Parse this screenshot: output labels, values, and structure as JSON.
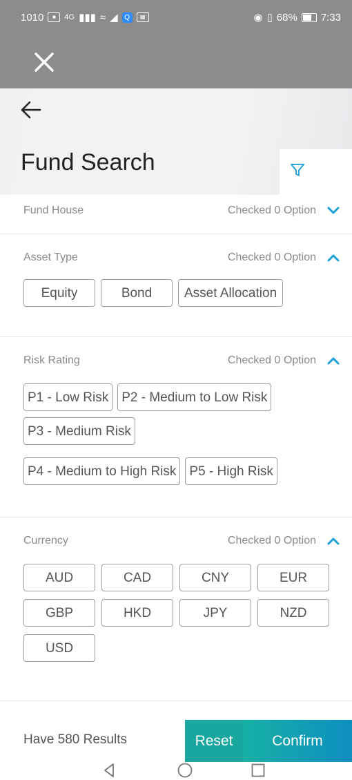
{
  "status_bar": {
    "carrier": "1010",
    "network": "4G",
    "battery_percent": "68%",
    "time": "7:33"
  },
  "header": {
    "title": "Fund Search"
  },
  "sections": [
    {
      "title": "Fund House",
      "status": "Checked 0 Option",
      "expanded": false,
      "options": []
    },
    {
      "title": "Asset Type",
      "status": "Checked 0 Option",
      "expanded": true,
      "options": [
        "Equity",
        "Bond",
        "Asset Allocation"
      ]
    },
    {
      "title": "Risk Rating",
      "status": "Checked 0 Option",
      "expanded": true,
      "options": [
        "P1 - Low Risk",
        "P2 - Medium to Low Risk",
        "P3 - Medium Risk",
        "P4 - Medium to High Risk",
        "P5 - High Risk"
      ]
    },
    {
      "title": "Currency",
      "status": "Checked 0 Option",
      "expanded": true,
      "options": [
        "AUD",
        "CAD",
        "CNY",
        "EUR",
        "GBP",
        "HKD",
        "JPY",
        "NZD",
        "USD"
      ]
    }
  ],
  "footer": {
    "results_text": "Have 580 Results",
    "reset_label": "Reset",
    "confirm_label": "Confirm"
  },
  "colors": {
    "accent": "#1a9fd6",
    "reset": "#1aa79f",
    "confirm_start": "#16b0a5",
    "confirm_end": "#0e8fc0"
  }
}
